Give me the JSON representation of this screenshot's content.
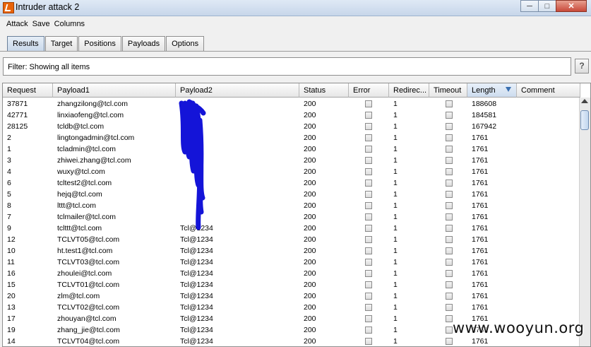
{
  "window": {
    "title": "Intruder attack 2"
  },
  "menu": [
    "Attack",
    "Save",
    "Columns"
  ],
  "tabs": [
    "Results",
    "Target",
    "Positions",
    "Payloads",
    "Options"
  ],
  "filter": {
    "text": "Filter:  Showing all items",
    "help": "?"
  },
  "table": {
    "columns": [
      "Request",
      "Payload1",
      "Payload2",
      "Status",
      "Error",
      "Redirec...",
      "Timeout",
      "Length",
      "Comment"
    ],
    "sorted_column": "Length",
    "rows": [
      [
        "37871",
        "zhangzilong@tcl.com",
        "",
        "200",
        "",
        "1",
        "",
        "188608",
        ""
      ],
      [
        "42771",
        "linxiaofeng@tcl.com",
        "",
        "200",
        "",
        "1",
        "",
        "184581",
        ""
      ],
      [
        "28125",
        "tcldb@tcl.com",
        "",
        "200",
        "",
        "1",
        "",
        "167942",
        ""
      ],
      [
        "2",
        "lingtongadmin@tcl.com",
        "",
        "200",
        "",
        "1",
        "",
        "1761",
        ""
      ],
      [
        "1",
        "tcladmin@tcl.com",
        "",
        "200",
        "",
        "1",
        "",
        "1761",
        ""
      ],
      [
        "3",
        "zhiwei.zhang@tcl.com",
        "",
        "200",
        "",
        "1",
        "",
        "1761",
        ""
      ],
      [
        "4",
        "wuxy@tcl.com",
        "",
        "200",
        "",
        "1",
        "",
        "1761",
        ""
      ],
      [
        "6",
        "tcltest2@tcl.com",
        "",
        "200",
        "",
        "1",
        "",
        "1761",
        ""
      ],
      [
        "5",
        "hejq@tcl.com",
        "",
        "200",
        "",
        "1",
        "",
        "1761",
        ""
      ],
      [
        "8",
        "lttt@tcl.com",
        "",
        "200",
        "",
        "1",
        "",
        "1761",
        ""
      ],
      [
        "7",
        "tclmailer@tcl.com",
        "",
        "200",
        "",
        "1",
        "",
        "1761",
        ""
      ],
      [
        "9",
        "tclttt@tcl.com",
        "Tcl@1234",
        "200",
        "",
        "1",
        "",
        "1761",
        ""
      ],
      [
        "12",
        "TCLVT05@tcl.com",
        "Tcl@1234",
        "200",
        "",
        "1",
        "",
        "1761",
        ""
      ],
      [
        "10",
        "ht.test1@tcl.com",
        "Tcl@1234",
        "200",
        "",
        "1",
        "",
        "1761",
        ""
      ],
      [
        "11",
        "TCLVT03@tcl.com",
        "Tcl@1234",
        "200",
        "",
        "1",
        "",
        "1761",
        ""
      ],
      [
        "16",
        "zhoulei@tcl.com",
        "Tcl@1234",
        "200",
        "",
        "1",
        "",
        "1761",
        ""
      ],
      [
        "15",
        "TCLVT01@tcl.com",
        "Tcl@1234",
        "200",
        "",
        "1",
        "",
        "1761",
        ""
      ],
      [
        "20",
        "zlm@tcl.com",
        "Tcl@1234",
        "200",
        "",
        "1",
        "",
        "1761",
        ""
      ],
      [
        "13",
        "TCLVT02@tcl.com",
        "Tcl@1234",
        "200",
        "",
        "1",
        "",
        "1761",
        ""
      ],
      [
        "17",
        "zhouyan@tcl.com",
        "Tcl@1234",
        "200",
        "",
        "1",
        "",
        "1761",
        ""
      ],
      [
        "19",
        "zhang_jie@tcl.com",
        "Tcl@1234",
        "200",
        "",
        "1",
        "",
        "1761",
        ""
      ],
      [
        "14",
        "TCLVT04@tcl.com",
        "Tcl@1234",
        "200",
        "",
        "1",
        "",
        "1761",
        ""
      ]
    ]
  },
  "watermark": "www.wooyun.org",
  "colors": {
    "redaction": "#1414d8",
    "sorted_header": "#cddcee"
  },
  "icons": {
    "window": [
      "minimize-icon",
      "maximize-icon",
      "close-icon"
    ],
    "sort": "sort-desc-icon"
  }
}
